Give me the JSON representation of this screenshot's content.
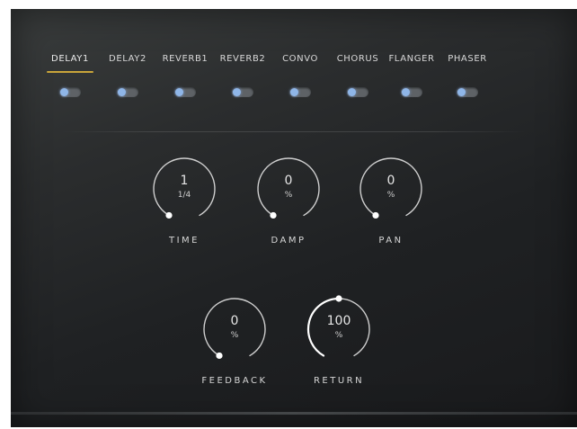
{
  "tabs": [
    {
      "label": "DELAY1",
      "active": true,
      "enabled": false
    },
    {
      "label": "DELAY2",
      "active": false,
      "enabled": false
    },
    {
      "label": "REVERB1",
      "active": false,
      "enabled": false
    },
    {
      "label": "REVERB2",
      "active": false,
      "enabled": false
    },
    {
      "label": "CONVO",
      "active": false,
      "enabled": false
    },
    {
      "label": "CHORUS",
      "active": false,
      "enabled": false
    },
    {
      "label": "FLANGER",
      "active": false,
      "enabled": false
    },
    {
      "label": "PHASER",
      "active": false,
      "enabled": false
    }
  ],
  "knobs": {
    "time": {
      "label": "TIME",
      "value": "1",
      "unit": "1/4",
      "level": 0.0
    },
    "damp": {
      "label": "DAMP",
      "value": "0",
      "unit": "%",
      "level": 0.0
    },
    "pan": {
      "label": "PAN",
      "value": "0",
      "unit": "%",
      "level": 0.0
    },
    "feedback": {
      "label": "FEEDBACK",
      "value": "0",
      "unit": "%",
      "level": 0.0
    },
    "return": {
      "label": "RETURN",
      "value": "100",
      "unit": "%",
      "level": 0.5
    }
  },
  "colors": {
    "accent": "#c9a43a",
    "toggle_thumb": "#8fb6e8",
    "knob_track": "#cfcfcf",
    "knob_active": "#ffffff"
  }
}
